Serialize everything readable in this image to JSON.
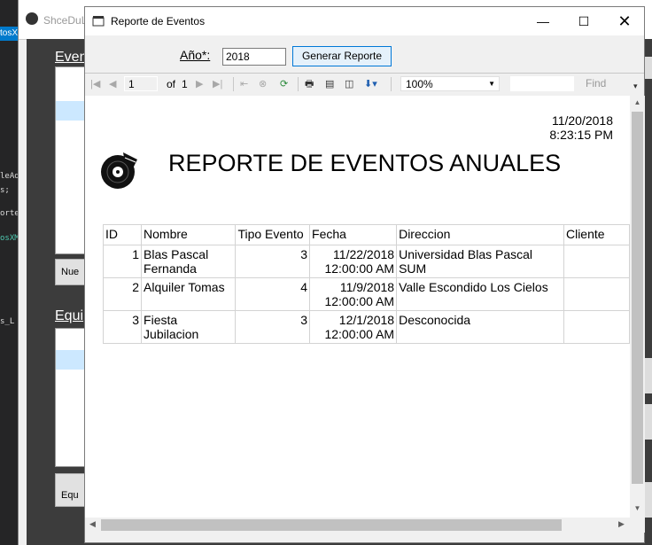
{
  "background": {
    "parent_title": "ShceDuLe",
    "tab_label": "tosX",
    "code_lines": [
      "leAd",
      "s;",
      "orte",
      "osXM",
      "s_L"
    ],
    "label_events": "Even",
    "label_equipment": "Equi",
    "button_new": "Nue",
    "button_equip": "Equ"
  },
  "window": {
    "title": "Reporte de Eventos",
    "minimize_glyph": "—",
    "maximize_glyph": "☐",
    "close_glyph": "✕"
  },
  "params": {
    "year_label": "Año*:",
    "year_value": "2018",
    "generate_label": "Generar Reporte"
  },
  "toolbar": {
    "page_current": "1",
    "page_of": "of",
    "page_total": "1",
    "zoom": "100%",
    "find_label": "Find"
  },
  "report": {
    "date": "11/20/2018",
    "time": "8:23:15 PM",
    "title": "REPORTE DE EVENTOS ANUALES",
    "columns": [
      "ID",
      "Nombre",
      "Tipo Evento",
      "Fecha",
      "Direccion",
      "Cliente"
    ],
    "rows": [
      {
        "id": "1",
        "nombre": "Blas Pascal Fernanda",
        "tipo": "3",
        "fecha": "11/22/2018 12:00:00 AM",
        "direccion": "Universidad Blas Pascal SUM",
        "cliente": ""
      },
      {
        "id": "2",
        "nombre": "Alquiler Tomas",
        "tipo": "4",
        "fecha": "11/9/2018 12:00:00 AM",
        "direccion": "Valle Escondido Los Cielos",
        "cliente": ""
      },
      {
        "id": "3",
        "nombre": "Fiesta Jubilacion",
        "tipo": "3",
        "fecha": "12/1/2018 12:00:00 AM",
        "direccion": "Desconocida",
        "cliente": ""
      }
    ]
  },
  "colors": {
    "accent": "#0078d7",
    "selection": "#cce8ff",
    "ide_dark": "#1e1e1e"
  }
}
